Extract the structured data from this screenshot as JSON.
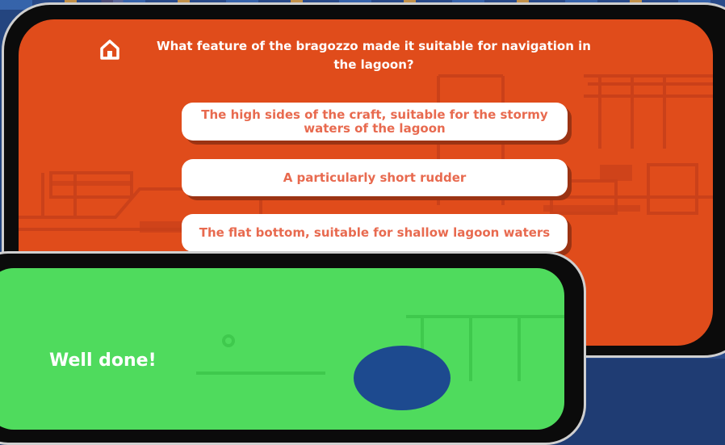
{
  "quiz": {
    "question": "What feature of the bragozzo made it suitable for navigation in the lagoon?",
    "answers": [
      "The high sides of the craft, suitable for the stormy waters of the lagoon",
      "A particularly short rudder",
      "The flat bottom, suitable for shallow lagoon waters"
    ]
  },
  "result": {
    "title": "Well done!"
  },
  "colors": {
    "quiz_bg": "#e04c1b",
    "answer_text": "#e86a4f",
    "result_bg": "#4fdb5d"
  },
  "icons": {
    "home": "home-icon"
  }
}
